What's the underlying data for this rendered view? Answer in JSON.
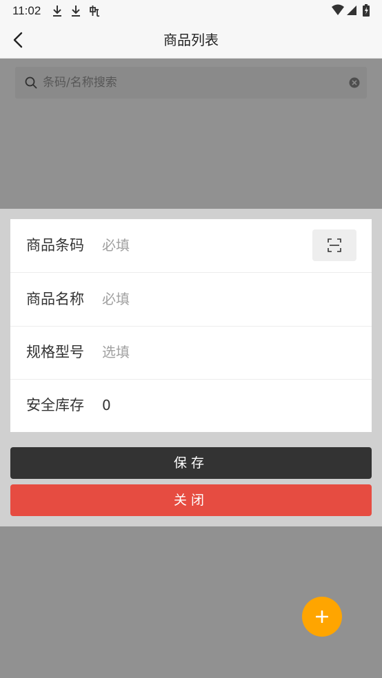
{
  "status_bar": {
    "time": "11:02",
    "icons": [
      "download-icon",
      "download-icon",
      "app-notification-icon"
    ],
    "right_icons": [
      "wifi-icon",
      "signal-icon",
      "battery-icon"
    ]
  },
  "navbar": {
    "title": "商品列表",
    "back_icon": "chevron-left-icon"
  },
  "search": {
    "placeholder": "条码/名称搜索",
    "value": ""
  },
  "form": {
    "fields": [
      {
        "label": "商品条码",
        "placeholder": "必填",
        "value": ""
      },
      {
        "label": "商品名称",
        "placeholder": "必填",
        "value": ""
      },
      {
        "label": "规格型号",
        "placeholder": "选填",
        "value": ""
      },
      {
        "label": "安全库存",
        "placeholder": "",
        "value": "0"
      }
    ],
    "scan_icon": "scan-icon"
  },
  "buttons": {
    "save": "保存",
    "close": "关闭"
  },
  "fab": {
    "icon": "plus-icon"
  },
  "colors": {
    "save_bg": "#333333",
    "close_bg": "#e64c41",
    "fab_bg": "#ffa500"
  }
}
